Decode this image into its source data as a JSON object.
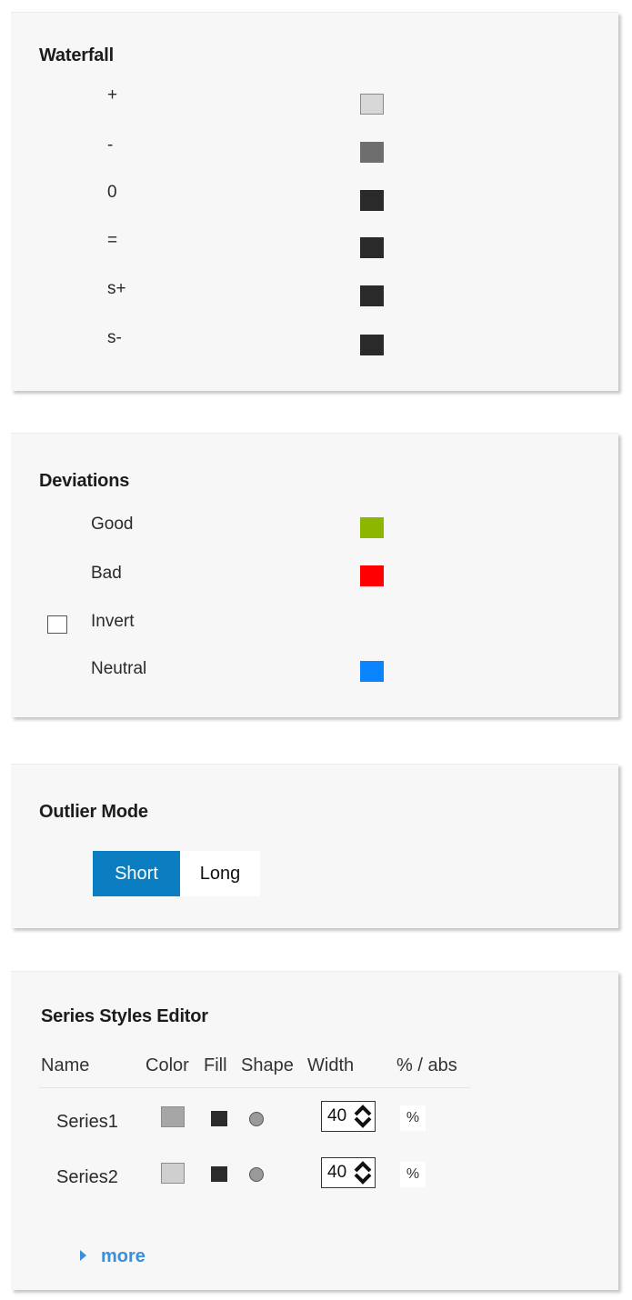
{
  "waterfall": {
    "title": "Waterfall",
    "items": [
      {
        "label": "+",
        "color": "#d8d8d8"
      },
      {
        "label": "-",
        "color": "#6e6e6e"
      },
      {
        "label": "0",
        "color": "#2a2a2a"
      },
      {
        "label": "=",
        "color": "#2a2a2a"
      },
      {
        "label": "s+",
        "color": "#2a2a2a"
      },
      {
        "label": "s-",
        "color": "#2a2a2a"
      }
    ]
  },
  "deviations": {
    "title": "Deviations",
    "good": {
      "label": "Good",
      "color": "#8db600"
    },
    "bad": {
      "label": "Bad",
      "color": "#ff0000"
    },
    "invert": {
      "label": "Invert",
      "checked": false
    },
    "neutral": {
      "label": "Neutral",
      "color": "#0a84ff"
    }
  },
  "outlier_mode": {
    "title": "Outlier Mode",
    "options": [
      "Short",
      "Long"
    ],
    "selected": "Short"
  },
  "series_styles": {
    "title": "Series Styles Editor",
    "headers": {
      "name": "Name",
      "color": "Color",
      "fill": "Fill",
      "shape": "Shape",
      "width": "Width",
      "unit": "% / abs"
    },
    "rows": [
      {
        "name": "Series1",
        "color": "#a6a6a6",
        "width": "40",
        "unit": "%"
      },
      {
        "name": "Series2",
        "color": "#cfcfcf",
        "width": "40",
        "unit": "%"
      }
    ],
    "more_label": "more"
  }
}
